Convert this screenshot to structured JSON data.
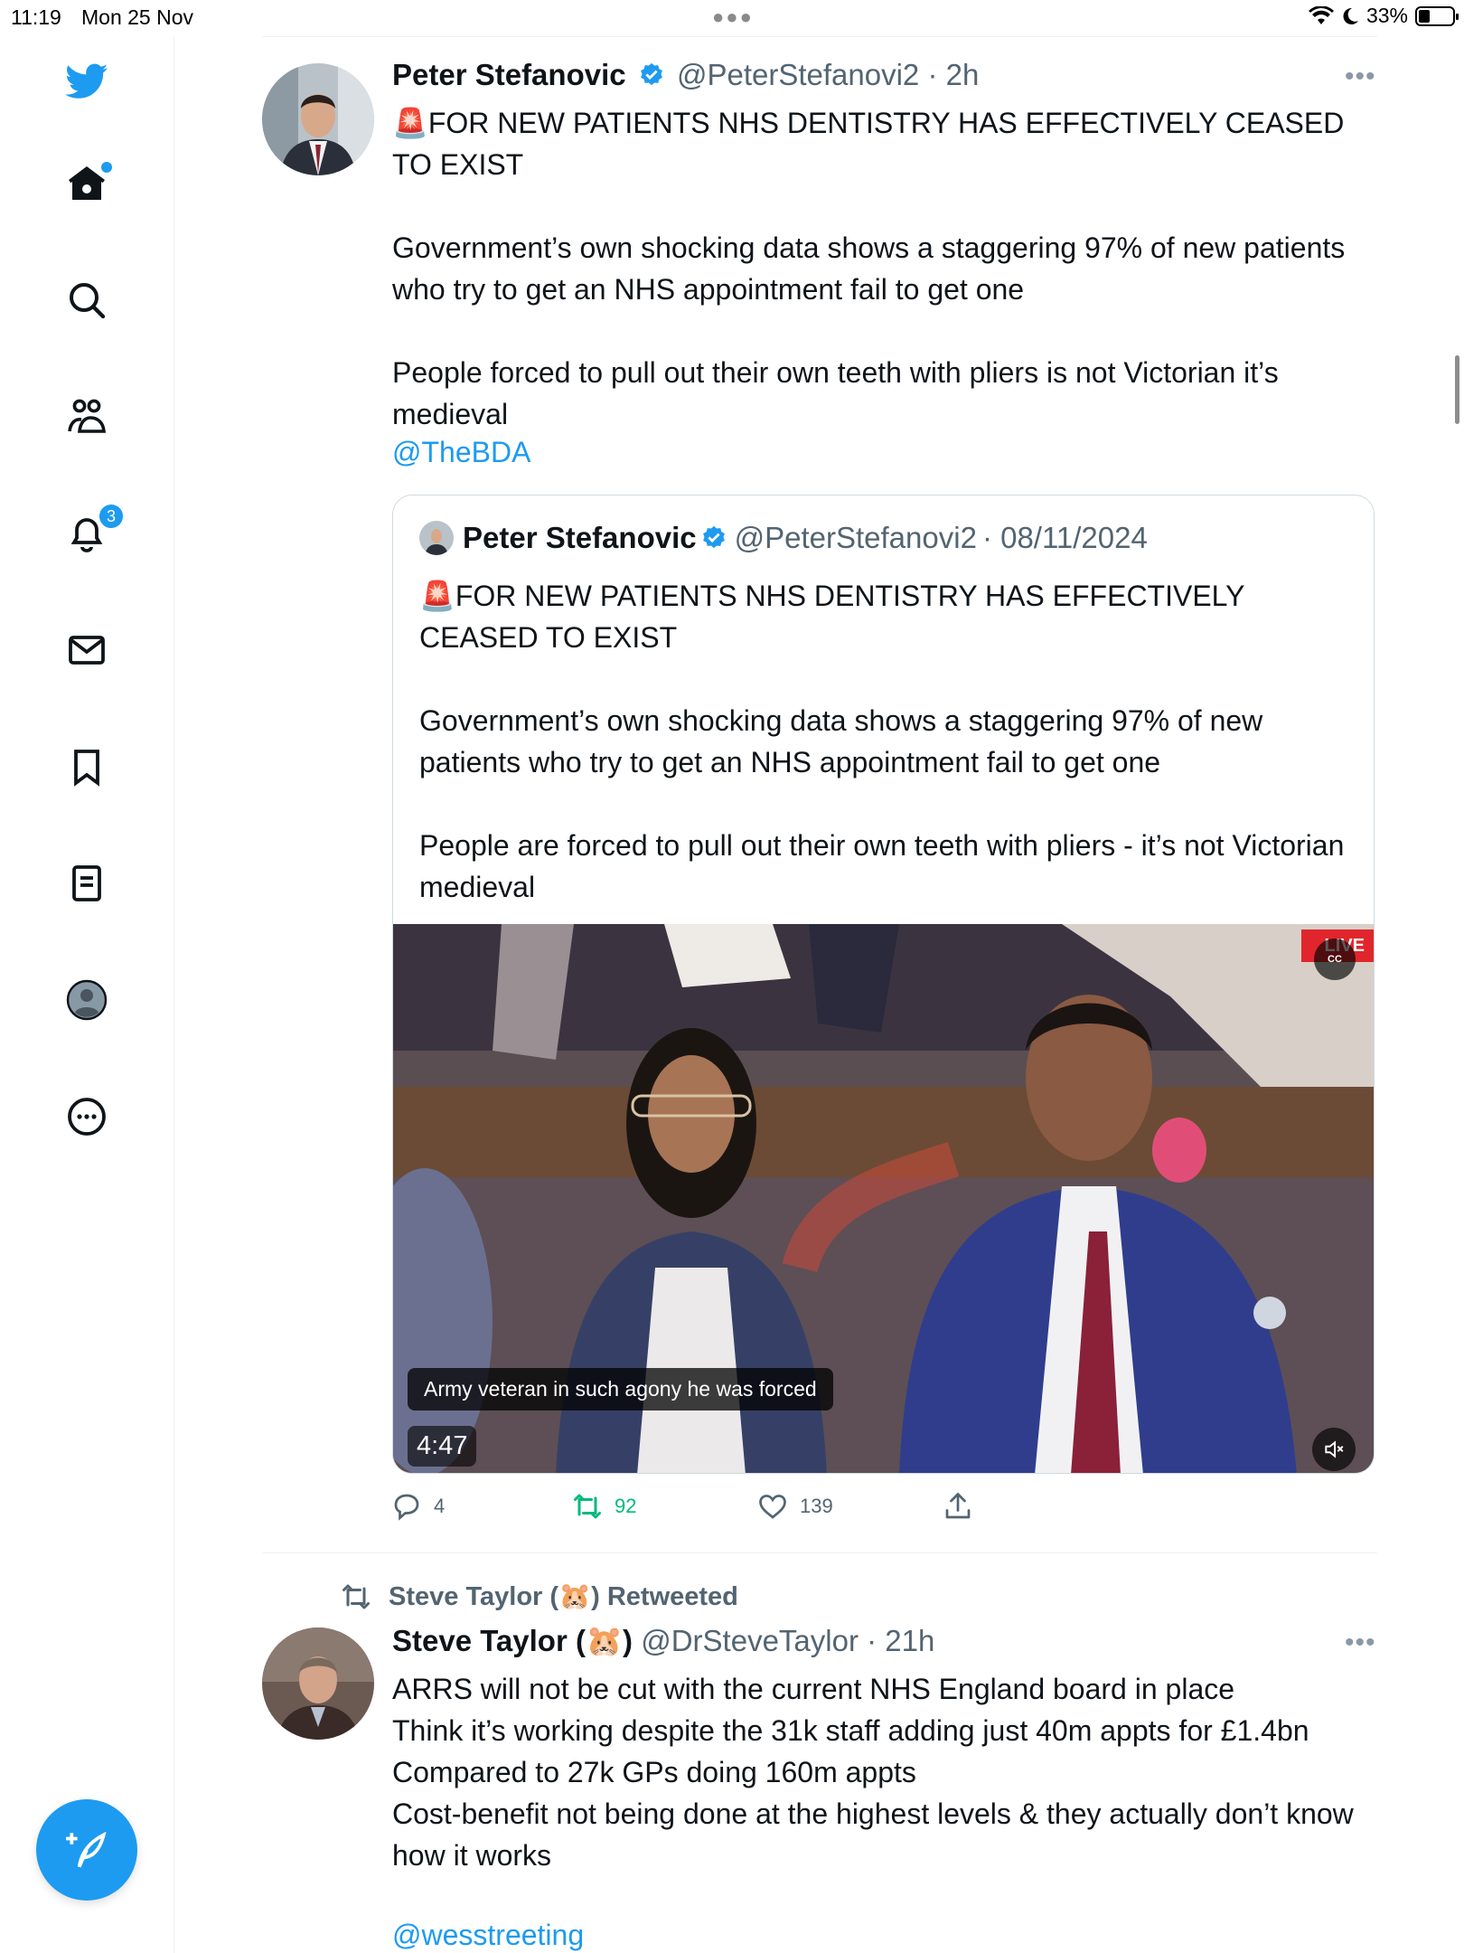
{
  "status_bar": {
    "time": "11:19",
    "date": "Mon 25 Nov",
    "battery": "33%",
    "battery_level": 0.33
  },
  "sidebar": {
    "items": [
      {
        "icon": "twitter-logo-icon"
      },
      {
        "icon": "home-icon"
      },
      {
        "icon": "search-icon"
      },
      {
        "icon": "communities-icon"
      },
      {
        "icon": "notifications-icon",
        "badge": "3"
      },
      {
        "icon": "messages-icon"
      },
      {
        "icon": "bookmarks-icon"
      },
      {
        "icon": "lists-icon"
      },
      {
        "icon": "profile-icon"
      },
      {
        "icon": "more-icon"
      }
    ],
    "compose_icon": "compose-tweet-icon"
  },
  "tweet1": {
    "name": "Peter Stefanovic",
    "handle": "@PeterStefanovi2",
    "time": "· 2h",
    "body": "🚨FOR NEW PATIENTS NHS DENTISTRY HAS EFFECTIVELY CEASED TO EXIST\n\nGovernment’s own shocking data shows a staggering 97% of new patients who try to get an NHS appointment fail to get one\n\nPeople forced to pull out their own teeth with pliers is not Victorian it’s medieval",
    "mention": "@TheBDA",
    "quote": {
      "name": "Peter Stefanovic",
      "handle": "@PeterStefanovi2",
      "time": "· 08/11/2024",
      "body": "🚨FOR NEW PATIENTS NHS DENTISTRY HAS EFFECTIVELY CEASED TO EXIST\n\nGovernment’s own shocking data shows a staggering 97% of new patients who try to get an NHS appointment fail to get one\n\nPeople are forced to pull out their own teeth with pliers - it’s not Victorian medieval",
      "video": {
        "caption": "Army veteran in such agony he was forced",
        "duration": "4:47",
        "live_label": "LIVE"
      }
    },
    "actions": {
      "replies": "4",
      "retweets": "92",
      "likes": "139"
    }
  },
  "tweet2": {
    "retweeted_by": "Steve Taylor (🐹) Retweeted",
    "name": "Steve Taylor (🐹)",
    "handle": "@DrSteveTaylor",
    "time": "· 21h",
    "body": "ARRS will not be cut with the current NHS England board in place\nThink it’s working despite the 31k staff adding just 40m appts for £1.4bn\nCompared to 27k GPs doing 160m appts\nCost-benefit not being done at the highest levels & they actually don’t know how it works",
    "mention": "@wesstreeting"
  },
  "colors": {
    "accent": "#1d9bf0",
    "retweet_green": "#00ba7c",
    "secondary_text": "#536471",
    "border": "#cfd9de"
  }
}
